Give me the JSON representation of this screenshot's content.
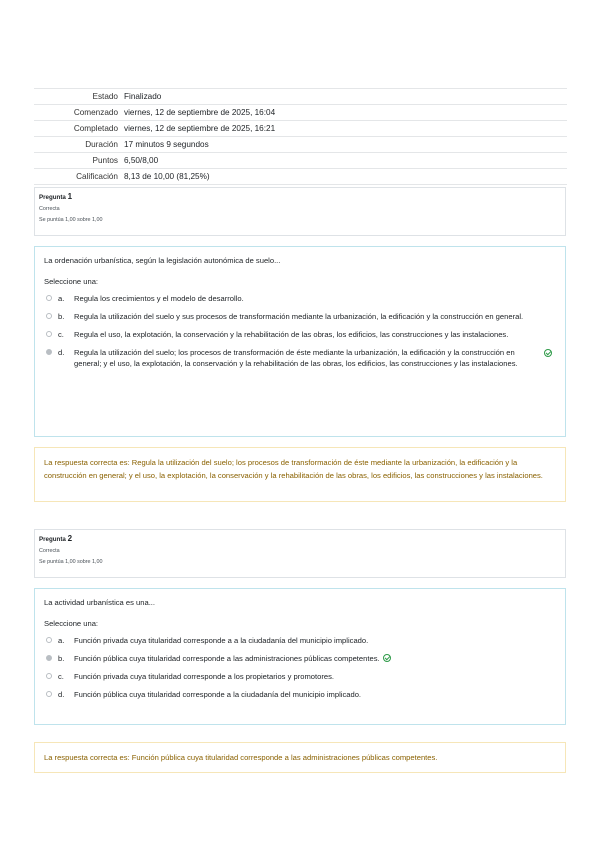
{
  "summary": {
    "rows": [
      {
        "label": "Estado",
        "value": "Finalizado"
      },
      {
        "label": "Comenzado",
        "value": "viernes, 12 de septiembre de 2025, 16:04"
      },
      {
        "label": "Completado",
        "value": "viernes, 12 de septiembre de 2025, 16:21"
      },
      {
        "label": "Duración",
        "value": "17 minutos 9 segundos"
      },
      {
        "label": "Puntos",
        "value": "6,50/8,00"
      },
      {
        "label": "Calificación",
        "value": "8,13 de 10,00 (81,25%)"
      }
    ]
  },
  "questions": [
    {
      "label": "Pregunta",
      "number": "1",
      "status": "Correcta",
      "score": "Se puntúa 1,00 sobre 1,00",
      "prompt": "La ordenación urbanística, según la legislación autonómica de suelo...",
      "select_label": "Seleccione una:",
      "options": [
        {
          "letter": "a.",
          "text": "Regula los crecimientos y el modelo de desarrollo."
        },
        {
          "letter": "b.",
          "text": "Regula la utilización del suelo y sus procesos de transformación mediante la urbanización, la edificación y la construcción en general."
        },
        {
          "letter": "c.",
          "text": "Regula el uso, la explotación, la conservación y la rehabilitación de las obras, los edificios, las construcciones y las instalaciones."
        },
        {
          "letter": "d.",
          "text": "Regula la utilización del suelo; los procesos de transformación de éste mediante la urbanización, la edificación y la construcción en general; y el uso, la explotación, la conservación y la rehabilitación de las obras, los edificios, las construcciones y las instalaciones."
        }
      ],
      "feedback": "La respuesta correcta es: Regula la utilización del suelo; los procesos de transformación de éste mediante la urbanización, la edificación y la construcción en general; y el uso, la explotación, la conservación y la rehabilitación de las obras, los edificios, las construcciones y las instalaciones."
    },
    {
      "label": "Pregunta",
      "number": "2",
      "status": "Correcta",
      "score": "Se puntúa 1,00 sobre 1,00",
      "prompt": "La actividad urbanística es una...",
      "select_label": "Seleccione una:",
      "options": [
        {
          "letter": "a.",
          "text": "Función privada cuya titularidad corresponde a a la ciudadanía del municipio implicado."
        },
        {
          "letter": "b.",
          "text": "Función pública cuya titularidad corresponde a las administraciones públicas competentes."
        },
        {
          "letter": "c.",
          "text": "Función privada cuya titularidad corresponde a los propietarios y promotores."
        },
        {
          "letter": "d.",
          "text": "Función pública cuya titularidad corresponde a la ciudadanía del municipio implicado."
        }
      ],
      "feedback": "La respuesta correcta es: Función pública cuya titularidad corresponde a las administraciones públicas competentes."
    }
  ],
  "icons": {
    "check": "check-circle-icon",
    "radio": "radio-icon"
  },
  "colors": {
    "correct": "#2e9a48",
    "feedback_text": "#8a6100",
    "question_border": "#bfe3ec",
    "feedback_border": "#f6e6b8"
  }
}
